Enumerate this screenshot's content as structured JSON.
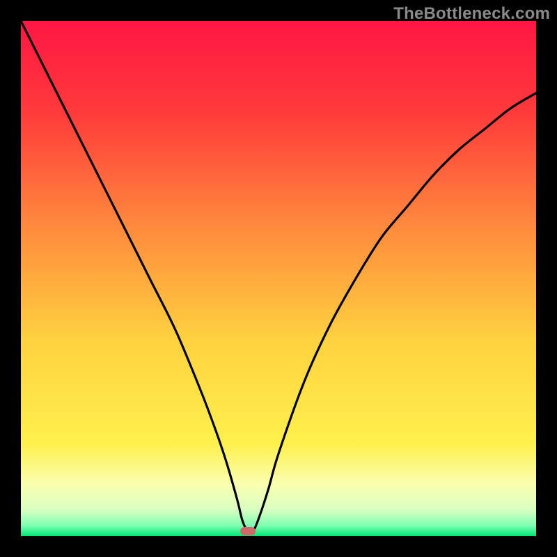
{
  "watermark": "TheBottleneck.com",
  "colors": {
    "marker": "#cf6a6a",
    "curve": "#000000",
    "gradient_stops": [
      {
        "offset": "0%",
        "color": "#ff1744"
      },
      {
        "offset": "18%",
        "color": "#ff3b3b"
      },
      {
        "offset": "40%",
        "color": "#ff8a3d"
      },
      {
        "offset": "62%",
        "color": "#ffd23f"
      },
      {
        "offset": "82%",
        "color": "#fff04d"
      },
      {
        "offset": "90%",
        "color": "#faffb0"
      },
      {
        "offset": "95%",
        "color": "#d7ffc2"
      },
      {
        "offset": "98%",
        "color": "#7dffb0"
      },
      {
        "offset": "100%",
        "color": "#00e676"
      }
    ]
  },
  "chart_data": {
    "type": "line",
    "title": "",
    "xlabel": "",
    "ylabel": "",
    "xlim": [
      0,
      100
    ],
    "ylim": [
      0,
      100
    ],
    "optimal_x": 44,
    "series": [
      {
        "name": "bottleneck-curve",
        "x": [
          0,
          5,
          10,
          15,
          20,
          25,
          30,
          35,
          38,
          40,
          42,
          43,
          44,
          45,
          46,
          48,
          50,
          55,
          60,
          65,
          70,
          75,
          80,
          85,
          90,
          95,
          100
        ],
        "y": [
          100,
          90,
          80,
          70,
          60,
          50,
          40,
          28,
          20,
          14,
          7,
          3,
          1,
          1,
          3,
          9,
          16,
          30,
          41,
          50,
          58,
          64,
          70,
          75,
          79,
          83,
          86
        ]
      }
    ],
    "marker": {
      "x": 44,
      "y": 1
    }
  }
}
